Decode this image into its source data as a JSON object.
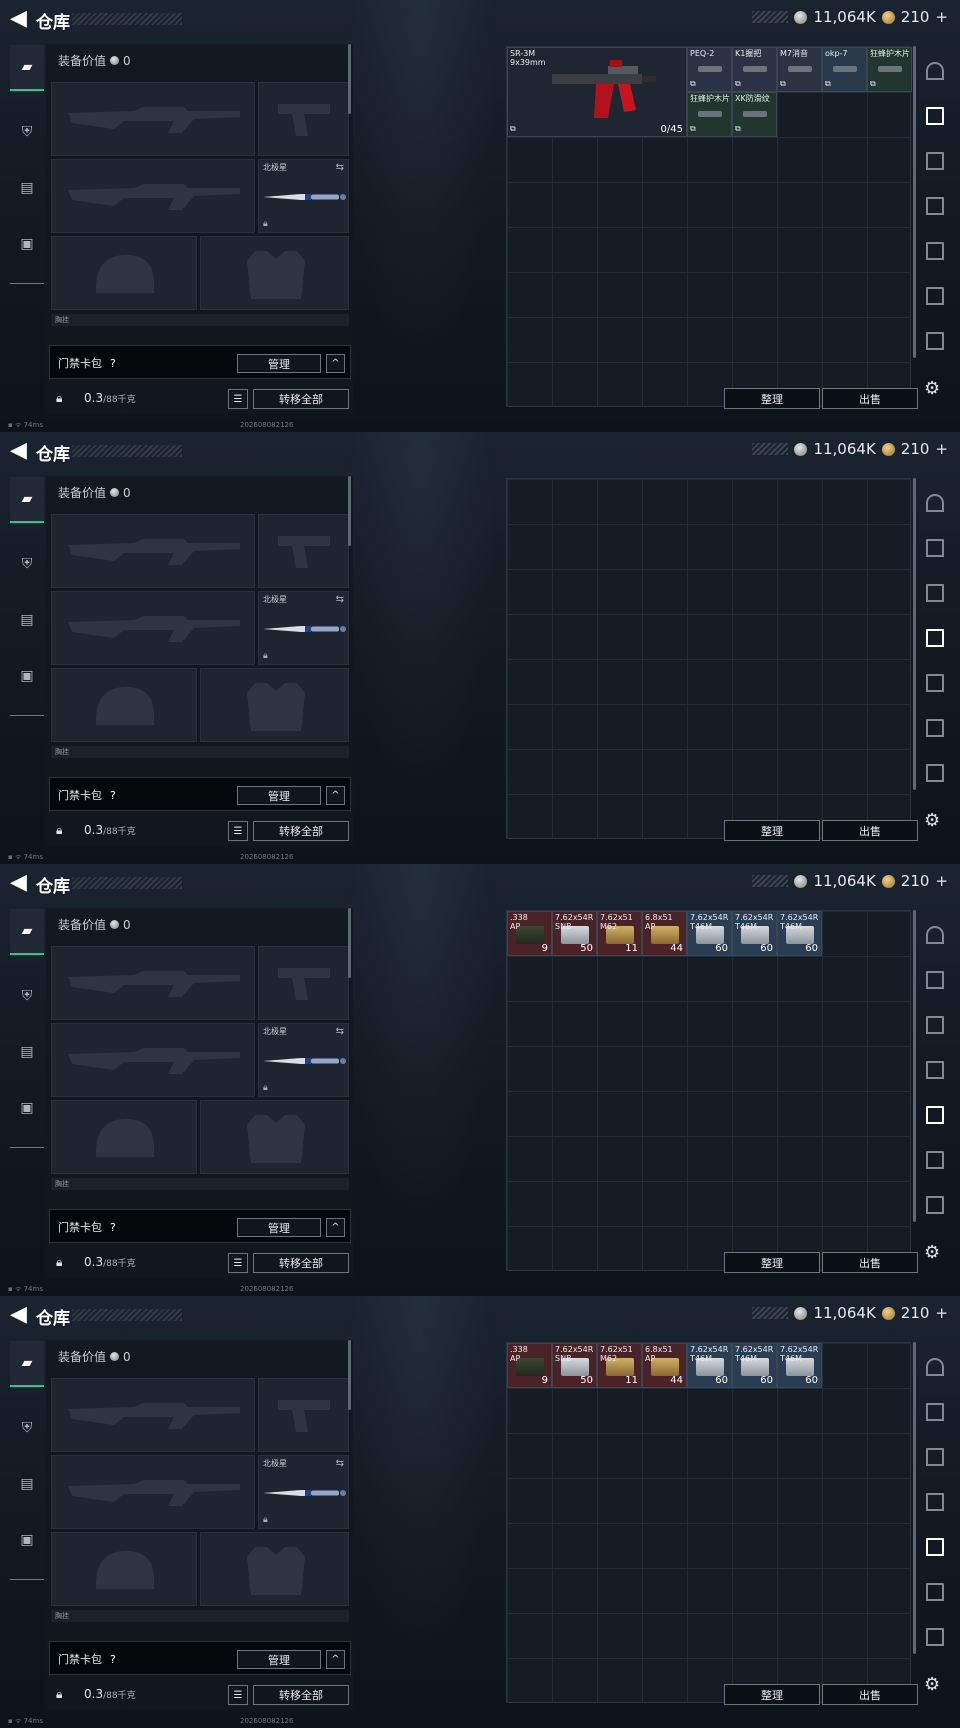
{
  "header": {
    "back_icon": "◀",
    "title": "仓库",
    "silver": "11,064K",
    "gold": "210",
    "gold_plus": "+"
  },
  "equipment": {
    "value_label": "装备价值",
    "value": "0",
    "knife_label": "北极星",
    "lower_label": "胸挂",
    "access_card": "门禁卡包",
    "question": "?",
    "manage": "管理",
    "collapse": "^",
    "weight": "0.3",
    "weight_max": "/88千克",
    "transfer_all": "转移全部"
  },
  "actions": {
    "sort": "整理",
    "sell": "出售"
  },
  "status": {
    "ping": "74ms",
    "build": "202608082126"
  },
  "frames": [
    {
      "active_right_tab": 1,
      "items": [
        {
          "name": "SR-3M\n9x39mm",
          "count": "0/45",
          "bg": "#1e2731",
          "type": "gun"
        },
        {
          "name": "PEQ-2",
          "bg": "#2b3244",
          "type": "attach"
        },
        {
          "name": "K1握把",
          "bg": "#2b3244",
          "type": "attach"
        },
        {
          "name": "M7消音",
          "bg": "#2b3244",
          "type": "attach"
        },
        {
          "name": "okp-7",
          "bg": "#2b3a4a",
          "type": "attach"
        },
        {
          "name": "狂蜂护木片",
          "bg": "#22362f",
          "type": "attach"
        },
        {
          "name": "狂蜂护木片",
          "bg": "#22362f",
          "type": "attach"
        },
        {
          "name": "XK防滑纹",
          "bg": "#22362f",
          "type": "attach"
        }
      ]
    },
    {
      "active_right_tab": 3,
      "items": []
    },
    {
      "active_right_tab": 4,
      "items": [
        {
          "name": ".338\nAP",
          "count": "9",
          "bg": "#4a2328"
        },
        {
          "name": "7.62x54R\nSNB",
          "count": "50",
          "bg": "#4a2328"
        },
        {
          "name": "7.62x51\nM62",
          "count": "11",
          "bg": "#4a2328"
        },
        {
          "name": "6.8x51\nAP",
          "count": "44",
          "bg": "#4a2328"
        },
        {
          "name": "7.62x54R\nT46M",
          "count": "60",
          "bg": "#2a3d52"
        },
        {
          "name": "7.62x54R\nT46M",
          "count": "60",
          "bg": "#2a3d52"
        },
        {
          "name": "7.62x54R\nT46M",
          "count": "60",
          "bg": "#2a3d52"
        }
      ]
    },
    {
      "active_right_tab": 4,
      "items": [
        {
          "name": ".338\nAP",
          "count": "9",
          "bg": "#4a2328"
        },
        {
          "name": "7.62x54R\nSNB",
          "count": "50",
          "bg": "#4a2328"
        },
        {
          "name": "7.62x51\nM62",
          "count": "11",
          "bg": "#4a2328"
        },
        {
          "name": "6.8x51\nAP",
          "count": "44",
          "bg": "#4a2328"
        },
        {
          "name": "7.62x54R\nT46M",
          "count": "60",
          "bg": "#2a3d52"
        },
        {
          "name": "7.62x54R\nT46M",
          "count": "60",
          "bg": "#2a3d52"
        },
        {
          "name": "7.62x54R\nT46M",
          "count": "60",
          "bg": "#2a3d52"
        }
      ]
    }
  ],
  "right_tabs": [
    "I",
    "II",
    "III",
    "IV",
    "V",
    "VI",
    "VII"
  ],
  "colors": {
    "accent": "#2ec4a0",
    "ammo_red": "#4a2328",
    "ammo_blue": "#2a3d52"
  }
}
